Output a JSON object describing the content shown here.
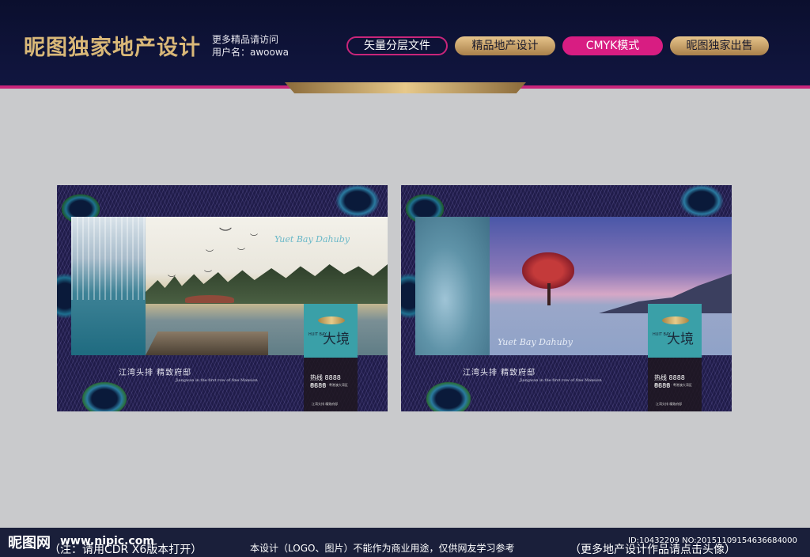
{
  "header": {
    "brand": "昵图独家地产设计",
    "subtitle_line1": "更多精品请访问",
    "subtitle_line2": "用户名：awoowa",
    "tags": [
      "矢量分层文件",
      "精品地产设计",
      "CMYK模式",
      "昵图独家出售"
    ]
  },
  "panels": [
    {
      "script_text": "Yuet Bay Dahuby",
      "logo_text": "大境",
      "logo_small": "HUIT BAY",
      "phone": "热线 8888 8888",
      "info": "地址：中国 · 粤港澳大湾区",
      "info_foot": "江湾头排 精致府邸",
      "slogan_cn": "江湾头排  精致府邸",
      "slogan_en": "Jiangwan in the first row of fine Mansion"
    },
    {
      "script_text": "Yuet Bay Dahuby",
      "logo_text": "大境",
      "logo_small": "HUIT BAY",
      "phone": "热线 8888 8888",
      "info": "地址：中国 · 粤港澳大湾区",
      "info_foot": "江湾头排 精致府邸",
      "slogan_cn": "江湾头排  精致府邸",
      "slogan_en": "Jiangwan in the first row of fine Mansion"
    }
  ],
  "footer": {
    "logo": "昵图网",
    "url": "www.nipic.com",
    "note_left": "（注：请用CDR X6版本打开）",
    "note_center": "本设计（LOGO、图片）不能作为商业用途，仅供网友学习参考",
    "note_right": "（更多地产设计作品请点击头像）",
    "id": "ID:10432209 NO:20151109154636684000"
  },
  "colors": {
    "header_bg": "#0b0f2e",
    "accent_pink": "#d81d82",
    "gold": "#d9b878",
    "page_bg": "#c9cacc",
    "teal_card": "#3aa0a8"
  }
}
